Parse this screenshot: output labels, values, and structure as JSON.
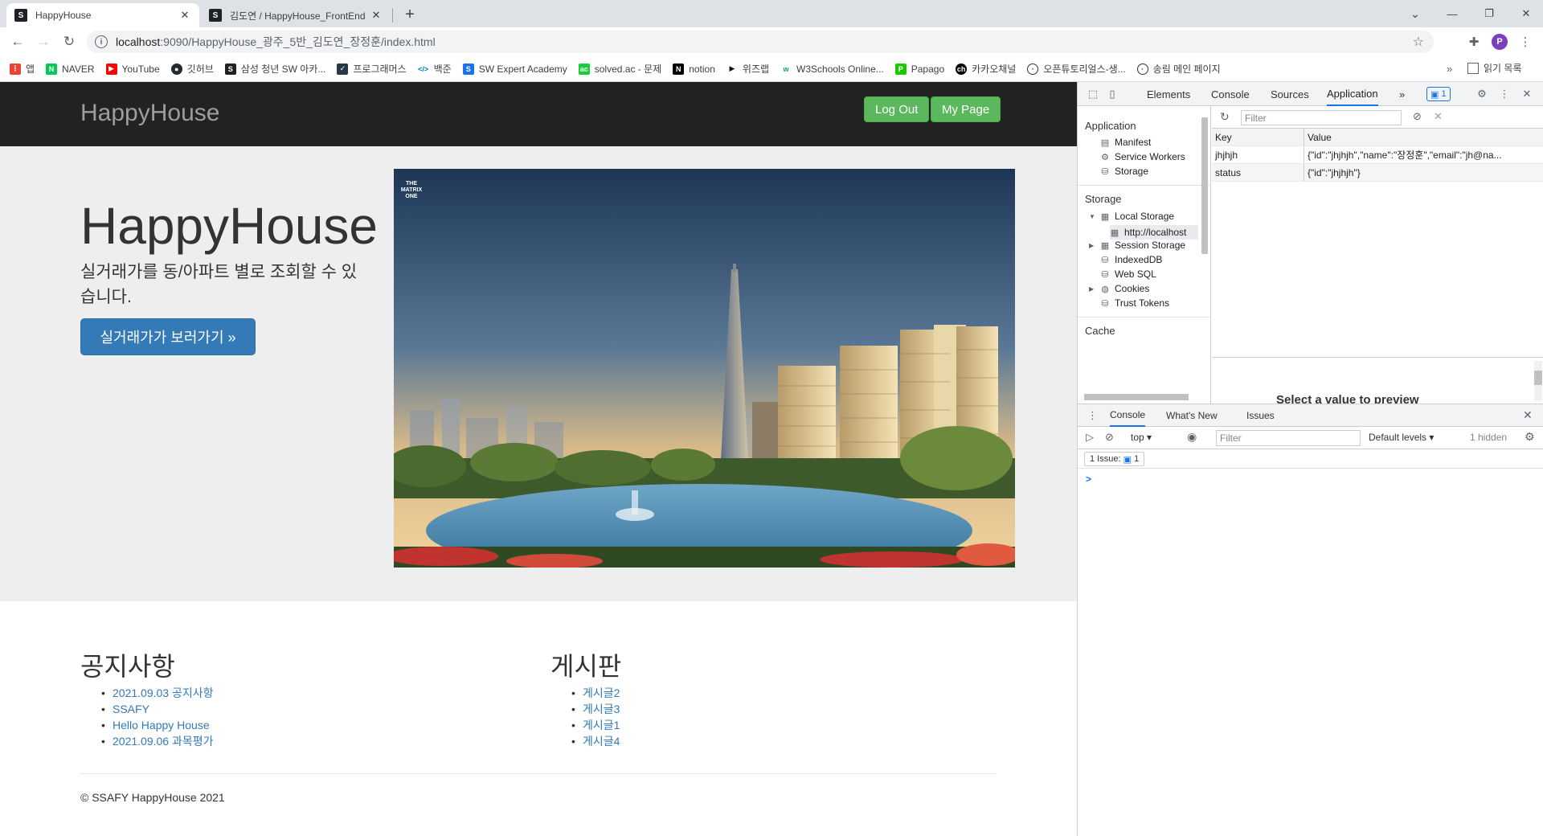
{
  "browser": {
    "tabs": [
      {
        "title": "HappyHouse",
        "active": true
      },
      {
        "title": "김도연 / HappyHouse_FrontEnd",
        "active": false
      }
    ],
    "url_host": "localhost",
    "url_path": ":9090/HappyHouse_광주_5반_김도연_장정훈/index.html",
    "bookmarks": [
      "앱",
      "NAVER",
      "YouTube",
      "깃허브",
      "삼성 청년 SW 아카...",
      "프로그래머스",
      "백준",
      "SW Expert Academy",
      "solved.ac - 문제",
      "notion",
      "위즈랩",
      "W3Schools Online...",
      "Papago",
      "카카오채널",
      "오픈튜토리얼스-생...",
      "송림 메인 페이지"
    ],
    "bookmarks_more": "»",
    "reading_list": "읽기 목록",
    "avatar_letter": "P"
  },
  "page": {
    "brand": "HappyHouse",
    "logout_label": "Log Out",
    "mypage_label": "My Page",
    "hero_title": "HappyHouse",
    "hero_subtitle": "실거래가를 동/아파트 별로 조회할 수 있습니다.",
    "hero_button": "실거래가가 보러가기 »",
    "hero_image_logo": "THE MATRIX ONE",
    "notice_title": "공지사항",
    "notice_items": [
      "2021.09.03 공지사항",
      "SSAFY",
      "Hello Happy House",
      "2021.09.06 과목평가"
    ],
    "board_title": "게시판",
    "board_items": [
      "게시글2",
      "게시글3",
      "게시글1",
      "게시글4"
    ],
    "footer": "© SSAFY HappyHouse 2021"
  },
  "devtools": {
    "tabs": [
      "Elements",
      "Console",
      "Sources",
      "Application"
    ],
    "active_tab": "Application",
    "more": "»",
    "issue_count": "1",
    "sidebar": {
      "application_head": "Application",
      "application_items": [
        "Manifest",
        "Service Workers",
        "Storage"
      ],
      "storage_head": "Storage",
      "storage_items": [
        "Local Storage",
        "http://localhost",
        "Session Storage",
        "IndexedDB",
        "Web SQL",
        "Cookies",
        "Trust Tokens"
      ],
      "cache_head": "Cache"
    },
    "filter_placeholder": "Filter",
    "table_headers": [
      "Key",
      "Value"
    ],
    "rows": [
      {
        "key": "jhjhjh",
        "value": "{\"id\":\"jhjhjh\",\"name\":\"장정훈\",\"email\":\"jh@na..."
      },
      {
        "key": "status",
        "value": "{\"id\":\"jhjhjh\"}"
      }
    ],
    "preview_text": "Select a value to preview",
    "drawer_tabs": [
      "Console",
      "What's New",
      "Issues"
    ],
    "context": "top",
    "console_filter": "Filter",
    "levels": "Default levels",
    "hidden": "1 hidden",
    "issue_label": "1 Issue:",
    "issue_badge": "1",
    "prompt": ">"
  }
}
